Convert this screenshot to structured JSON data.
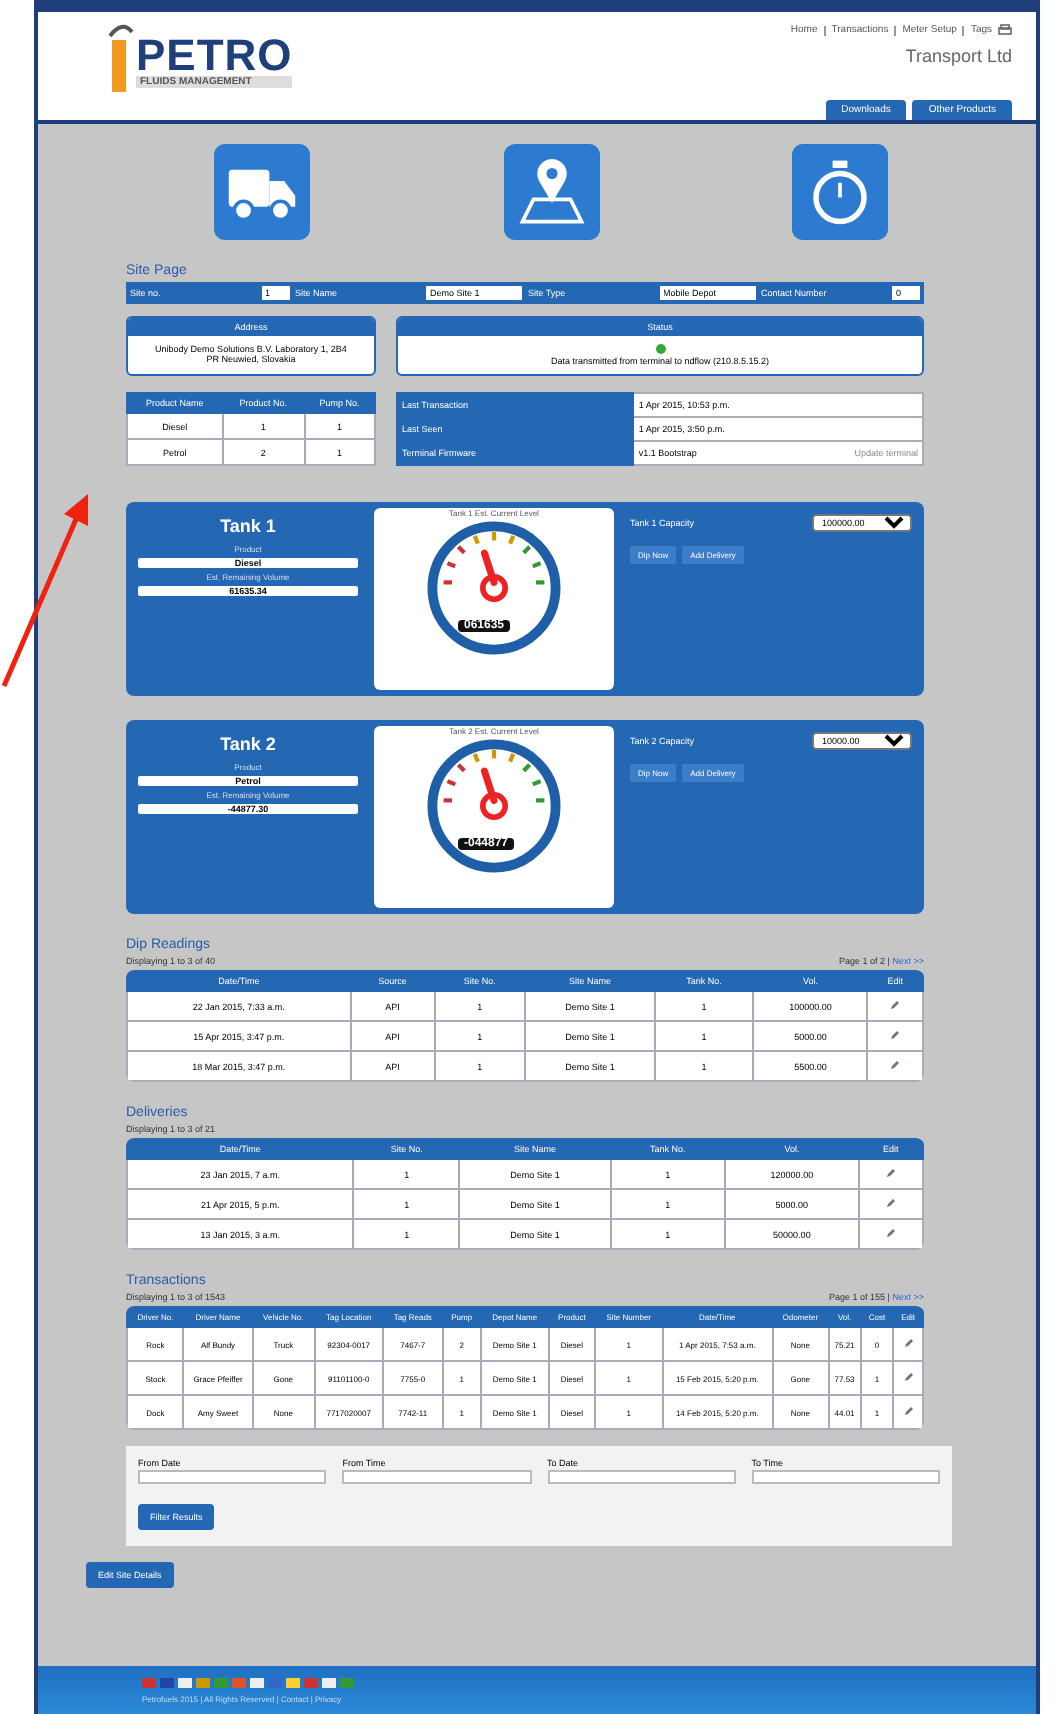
{
  "header": {
    "logo": {
      "word": "PETRO",
      "tagline": "FLUIDS MANAGEMENT"
    },
    "nav": [
      "Home",
      "Transactions",
      "Meter Setup",
      "Tags"
    ],
    "company": "Transport Ltd",
    "links": [
      "Downloads",
      "Other Products"
    ]
  },
  "site": {
    "title": "Site Page",
    "fields": [
      {
        "label": "Site no.",
        "value": "1"
      },
      {
        "label": "Site Name",
        "value": "Demo Site 1"
      },
      {
        "label": "Site Type",
        "value": "Mobile Depot"
      },
      {
        "label": "Contact Number",
        "value": "0"
      }
    ],
    "address": {
      "title": "Address",
      "text": "Unibody Demo Solutions B.V. Laboratory 1, 2B4 PR Neuwied, Slovakia"
    },
    "status": {
      "title": "Status",
      "text": "Data transmitted from terminal to ndflow (210.8.5.15.2)"
    },
    "products": {
      "columns": [
        "Product Name",
        "Product No.",
        "Pump No."
      ],
      "rows": [
        [
          "Diesel",
          "1",
          "1"
        ],
        [
          "Petrol",
          "2",
          "1"
        ]
      ]
    },
    "info": [
      {
        "label": "Last Transaction",
        "value": "1 Apr 2015, 10:53 p.m."
      },
      {
        "label": "Last Seen",
        "value": "1 Apr 2015, 3:50 p.m."
      },
      {
        "label": "Terminal Firmware",
        "value": "v1.1 Bootstrap",
        "link": "Update terminal"
      }
    ]
  },
  "tanks": [
    {
      "title": "Tank 1",
      "product_label": "Product",
      "product": "Diesel",
      "volume_label": "Est. Remaining Volume",
      "volume": "61635.34",
      "gauge_title": "Tank 1 Est. Current Level",
      "readout": "061635",
      "capacity_label": "Tank 1 Capacity",
      "capacity": "100000.00",
      "buttons": [
        "Dip Now",
        "Add Delivery"
      ]
    },
    {
      "title": "Tank 2",
      "product_label": "Product",
      "product": "Petrol",
      "volume_label": "Est. Remaining Volume",
      "volume": "-44877.30",
      "gauge_title": "Tank 2 Est. Current Level",
      "readout": "-044877",
      "capacity_label": "Tank 2 Capacity",
      "capacity": "10000.00",
      "buttons": [
        "Dip Now",
        "Add Delivery"
      ]
    }
  ],
  "dips": {
    "title": "Dip Readings",
    "count": "Displaying 1 to 3 of 40",
    "pager": "Page 1 of 2 |",
    "next": "Next >>",
    "columns": [
      "Date/Time",
      "Source",
      "Site No.",
      "Site Name",
      "Tank No.",
      "Vol.",
      "Edit"
    ],
    "rows": [
      [
        "22 Jan 2015, 7:33 a.m.",
        "API",
        "1",
        "Demo Site 1",
        "1",
        "100000.00"
      ],
      [
        "15 Apr 2015, 3:47 p.m.",
        "API",
        "1",
        "Demo Site 1",
        "1",
        "5000.00"
      ],
      [
        "18 Mar 2015, 3:47 p.m.",
        "API",
        "1",
        "Demo Site 1",
        "1",
        "5500.00"
      ]
    ]
  },
  "deliveries": {
    "title": "Deliveries",
    "count": "Displaying 1 to 3 of 21",
    "columns": [
      "Date/Time",
      "Site No.",
      "Site Name",
      "Tank No.",
      "Vol.",
      "Edit"
    ],
    "rows": [
      [
        "23 Jan 2015, 7 a.m.",
        "1",
        "Demo Site 1",
        "1",
        "120000.00"
      ],
      [
        "21 Apr 2015, 5 p.m.",
        "1",
        "Demo Site 1",
        "1",
        "5000.00"
      ],
      [
        "13 Jan 2015, 3 a.m.",
        "1",
        "Demo Site 1",
        "1",
        "50000.00"
      ]
    ]
  },
  "transactions": {
    "title": "Transactions",
    "count": "Displaying 1 to 3 of 1543",
    "pager": "Page 1 of 155 |",
    "next": "Next >>",
    "columns": [
      "Driver No.",
      "Driver Name",
      "Vehicle No.",
      "Tag Location",
      "Tag Reads",
      "Pump",
      "Depot Name",
      "Product",
      "Site Number",
      "Date/Time",
      "Odometer",
      "Vol.",
      "Cost",
      "Edit"
    ],
    "rows": [
      [
        "Rock",
        "Alf Bundy",
        "Truck",
        "92304-0017",
        "7467-7",
        "2",
        "Demo Site 1",
        "Diesel",
        "1",
        "1 Apr 2015, 7:53 a.m.",
        "None",
        "75.21",
        "0"
      ],
      [
        "Stock",
        "Grace Pfeiffer",
        "Gone",
        "91101100-0",
        "7755-0",
        "1",
        "Demo Site 1",
        "Diesel",
        "1",
        "15 Feb 2015, 5:20 p.m.",
        "Gone",
        "77.53",
        "1"
      ],
      [
        "Dock",
        "Amy Sweet",
        "None",
        "7717020007",
        "7742-11",
        "1",
        "Demo Site 1",
        "Diesel",
        "1",
        "14 Feb 2015, 5:20 p.m.",
        "None",
        "44.01",
        "1"
      ]
    ]
  },
  "filter": {
    "fields": [
      "From Date",
      "From Time",
      "To Date",
      "To Time"
    ],
    "button": "Filter Results"
  },
  "edit_button": "Edit Site Details",
  "footer": {
    "text": "Petrofuels 2015 | All Rights Reserved | Contact | Privacy"
  }
}
